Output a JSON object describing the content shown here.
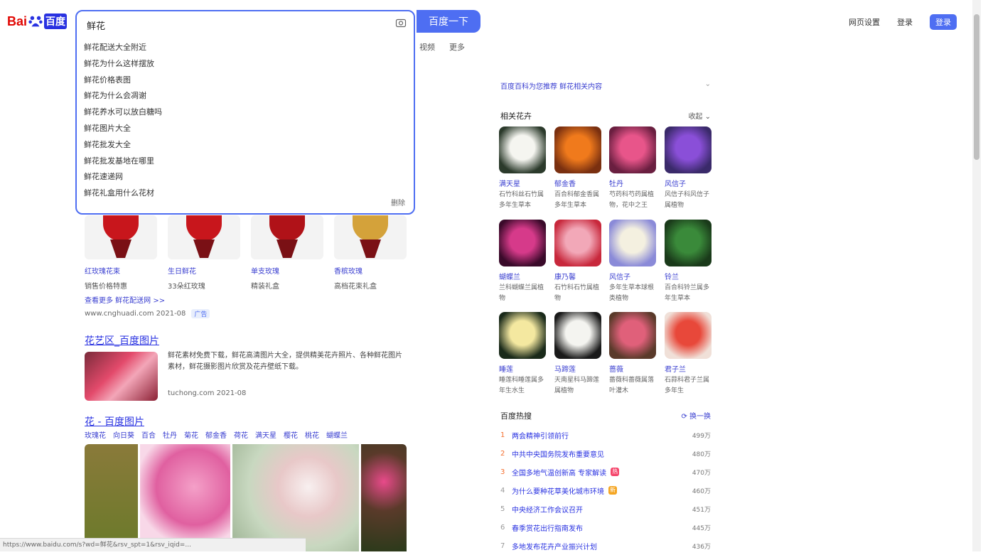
{
  "header": {
    "logo": {
      "left": "Bai",
      "right": "百度"
    },
    "search_value": "鲜花",
    "search_button": "百度一下",
    "top_links": [
      "网页设置",
      "登录"
    ],
    "login": "登录"
  },
  "suggestions": [
    "鲜花配送大全附近",
    "鲜花为什么这样摆放",
    "鲜花价格表图",
    "鲜花为什么会凋谢",
    "鲜花养水可以放白糖吗",
    "鲜花图片大全",
    "鲜花批发大全",
    "鲜花批发基地在哪里",
    "鲜花速递网",
    "鲜花礼盒用什么花材"
  ],
  "suggestion_delete": "删除",
  "nav_tabs": [
    "视频",
    "更多"
  ],
  "products": [
    {
      "title": "红玫瑰花束",
      "sub": "销售价格特惠",
      "color": "#c8161c"
    },
    {
      "title": "生日鲜花",
      "sub": "33朵红玫瑰",
      "color": "#c8161c"
    },
    {
      "title": "单支玫瑰",
      "sub": "精装礼盒",
      "color": "#b01218"
    },
    {
      "title": "香槟玫瑰",
      "sub": "高档花束礼盒",
      "color": "#d4a23a"
    }
  ],
  "result1": {
    "more": "查看更多 鲜花配送网 >>",
    "site": "www.cnghuadi.com 2021-08",
    "badge": "广告"
  },
  "result2": {
    "title": "花艺区_百度图片",
    "desc": "鲜花素材免费下载，鲜花高清图片大全，提供精美花卉照片、各种鲜花图片素材，鲜花摄影图片欣赏及花卉壁纸下载。",
    "site": "tuchong.com 2021-08"
  },
  "result3": {
    "title": "花 - 百度图片",
    "tags": [
      "玫瑰花",
      "向日葵",
      "百合",
      "牡丹",
      "菊花",
      "郁金香",
      "荷花",
      "满天星",
      "樱花",
      "桃花",
      "蝴蝶兰"
    ]
  },
  "status_bar": "https://www.baidu.com/s?wd=鲜花&rsv_spt=1&rsv_iqid=...",
  "right": {
    "ai_text": "百度百科为您推荐 鲜花相关内容",
    "related_title": "相关花卉",
    "related_collapse": "收起",
    "flowers": [
      {
        "name": "满天星",
        "desc": "石竹科丝石竹属多年生草本",
        "c1": "#f5f5f0",
        "c2": "#2b3a2b"
      },
      {
        "name": "郁金香",
        "desc": "百合科郁金香属多年生草本",
        "c1": "#f07a1c",
        "c2": "#7a3010"
      },
      {
        "name": "牡丹",
        "desc": "芍药科芍药属植物，花中之王",
        "c1": "#e8558a",
        "c2": "#6a1f40"
      },
      {
        "name": "风信子",
        "desc": "风信子科风信子属植物",
        "c1": "#8a4fd8",
        "c2": "#3a2a6a"
      },
      {
        "name": "蝴蝶兰",
        "desc": "兰科蝴蝶兰属植物",
        "c1": "#d63a8a",
        "c2": "#3a0a2a"
      },
      {
        "name": "康乃馨",
        "desc": "石竹科石竹属植物",
        "c1": "#f2a8b8",
        "c2": "#c8283c"
      },
      {
        "name": "风信子",
        "desc": "多年生草本球根类植物",
        "c1": "#f4f0e0",
        "c2": "#8a8ad8"
      },
      {
        "name": "铃兰",
        "desc": "百合科铃兰属多年生草本",
        "c1": "#3a8a3a",
        "c2": "#1a3a1a"
      },
      {
        "name": "睡莲",
        "desc": "睡莲科睡莲属多年生水生",
        "c1": "#f4e8a0",
        "c2": "#1a2a1a"
      },
      {
        "name": "马蹄莲",
        "desc": "天南星科马蹄莲属植物",
        "c1": "#f4f4f0",
        "c2": "#1a1a1a"
      },
      {
        "name": "蔷薇",
        "desc": "蔷薇科蔷薇属落叶灌木",
        "c1": "#e0607a",
        "c2": "#5a3a2a"
      },
      {
        "name": "君子兰",
        "desc": "石蒜科君子兰属多年生",
        "c1": "#e8483a",
        "c2": "#f0e0d8"
      }
    ],
    "hot_title": "百度热搜",
    "hot_refresh": "换一换",
    "hot": [
      {
        "rank": "1",
        "text": "两会精神引领前行",
        "heat": "499万",
        "tag": ""
      },
      {
        "rank": "2",
        "text": "中共中央国务院发布重要意见",
        "heat": "480万",
        "tag": ""
      },
      {
        "rank": "3",
        "text": "全国多地气温创新高 专家解读",
        "heat": "470万",
        "tag": "热"
      },
      {
        "rank": "4",
        "text": "为什么要种花草美化城市环境",
        "heat": "460万",
        "tag": "新"
      },
      {
        "rank": "5",
        "text": "中央经济工作会议召开",
        "heat": "451万",
        "tag": ""
      },
      {
        "rank": "6",
        "text": "春季赏花出行指南发布",
        "heat": "445万",
        "tag": ""
      },
      {
        "rank": "7",
        "text": "多地发布花卉产业振兴计划",
        "heat": "436万",
        "tag": ""
      }
    ],
    "colors": {
      "accent": "#4e6ef2",
      "link": "#2932e1",
      "hot_rank": "#f46e2e",
      "tag_hot": "#f5456b",
      "tag_new": "#f5a623"
    }
  }
}
